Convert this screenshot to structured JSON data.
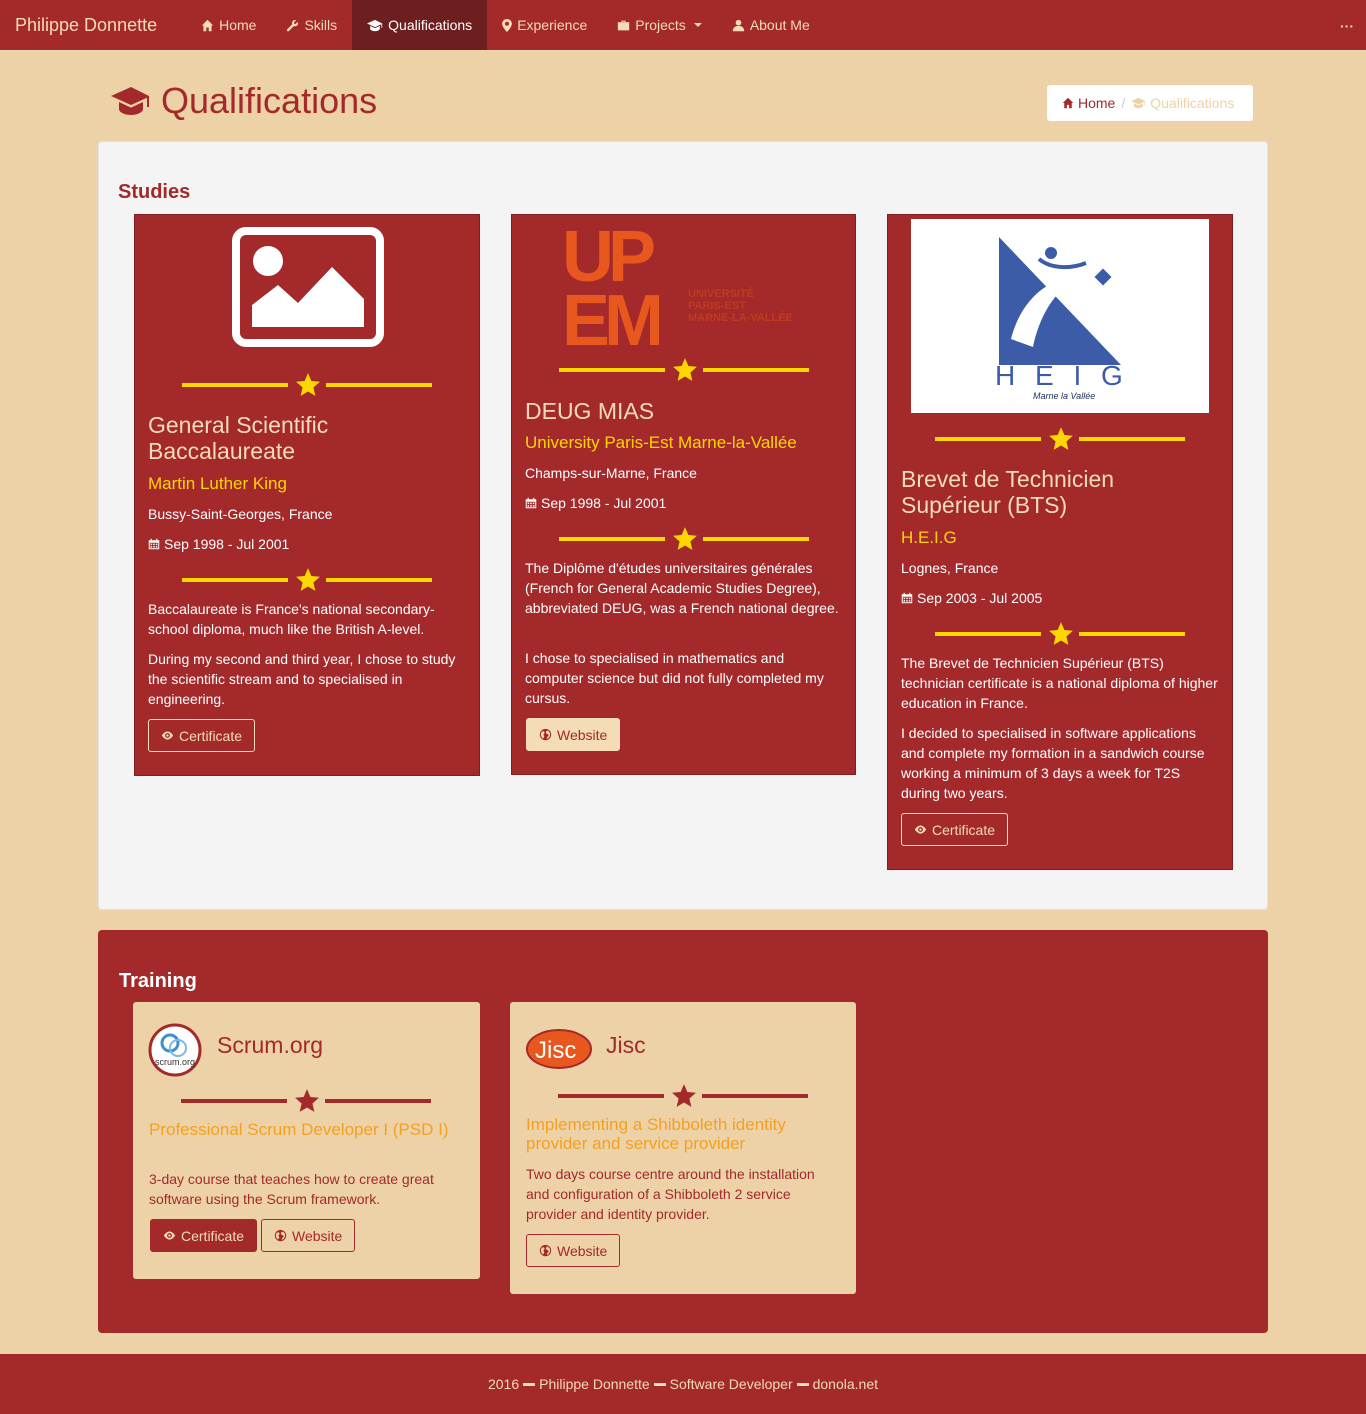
{
  "navbar": {
    "brand": "Philippe Donnette",
    "items": [
      {
        "label": "Home"
      },
      {
        "label": "Skills"
      },
      {
        "label": "Qualifications"
      },
      {
        "label": "Experience"
      },
      {
        "label": "Projects"
      },
      {
        "label": "About Me"
      }
    ],
    "more": "···"
  },
  "header": {
    "title": "Qualifications",
    "breadcrumb": {
      "home": "Home",
      "current": "Qualifications"
    }
  },
  "studies": {
    "title": "Studies",
    "cards": [
      {
        "title": "General Scientific Baccalaureate",
        "school": "Martin Luther King",
        "location": "Bussy-Saint-Georges, France",
        "date": "Sep 1998 - Jul 2001",
        "desc1": "Baccalaureate is France's national secondary-school diploma, much like the British A-level.",
        "desc2": "During my second and third year, I chose to study the scientific stream and to specialised in engineering.",
        "button": "Certificate"
      },
      {
        "title": "DEUG MIAS",
        "school": "University Paris-Est Marne-la-Vallée",
        "location": "Champs-sur-Marne, France",
        "date": "Sep 1998 - Jul 2001",
        "desc1": "The Diplôme d'études universitaires générales (French for General Academic Studies Degree), abbreviated DEUG, was a French national degree.",
        "desc2": "I chose to specialised in mathematics and computer science but did not fully completed my cursus.",
        "button": "Website",
        "logo": {
          "line1": "UP",
          "line2": "EM",
          "text1": "UNIVERSITÉ",
          "text2": "PARIS-EST",
          "text3": "MARNE-LA-VALLÉE"
        }
      },
      {
        "title": "Brevet de Technicien Supérieur (BTS)",
        "school": "H.E.I.G",
        "location": "Lognes, France",
        "date": "Sep 2003 - Jul 2005",
        "desc1": "The Brevet de Technicien Supérieur (BTS) technician certificate is a national diploma of higher education in France.",
        "desc2": "I decided to specialised in software applications and complete my formation in a sandwich course working a minimum of 3 days a week for T2S during two years.",
        "button": "Certificate",
        "logo": {
          "name": "H E I G",
          "place": "Marne la Vallée"
        }
      }
    ]
  },
  "training": {
    "title": "Training",
    "cards": [
      {
        "org": "Scrum.org",
        "logo_text": "scrum.org",
        "course": "Professional Scrum Developer I (PSD I)",
        "desc": "3-day course that teaches how to create great software using the Scrum framework.",
        "buttons": [
          "Certificate",
          "Website"
        ]
      },
      {
        "org": "Jisc",
        "logo_text": "Jisc",
        "course": "Implementing a Shibboleth identity provider and service provider",
        "desc": "Two days course centre around the installation and configuration of a Shibboleth 2 service provider and identity provider.",
        "buttons": [
          "Website"
        ]
      }
    ]
  },
  "footer": {
    "year": "2016",
    "name": "Philippe Donnette",
    "role": "Software Developer",
    "site": "donola.net"
  },
  "colors": {
    "primary": "#a3292b",
    "background": "#edd2a7",
    "accent": "#ffd700",
    "orange": "#f4a022"
  }
}
